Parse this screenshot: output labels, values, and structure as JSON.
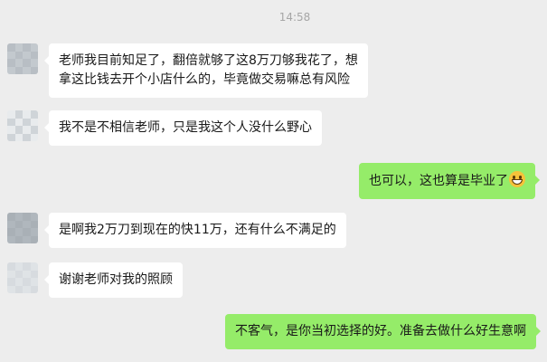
{
  "chat": {
    "timestamp": "14:58",
    "messages": [
      {
        "side": "left",
        "lines": [
          "老师我目前知足了，翻倍就够了这8万刀够我花了，想",
          "拿这比钱去开个小店什么的，毕竟做交易嘛总有风险"
        ]
      },
      {
        "side": "left",
        "lines": [
          "我不是不相信老师，只是我这个人没什么野心"
        ]
      },
      {
        "side": "right",
        "lines": [
          "也可以，这也算是毕业了"
        ],
        "emoji": "grinning-face-icon"
      },
      {
        "side": "left",
        "lines": [
          "是啊我2万刀到现在的快11万，还有什么不满足的"
        ]
      },
      {
        "side": "left",
        "lines": [
          "谢谢老师对我的照顾"
        ]
      },
      {
        "side": "right",
        "lines": [
          "不客气，是你当初选择的好。准备去做什么好生意啊"
        ]
      }
    ]
  },
  "colors": {
    "background": "#ededed",
    "incoming_bubble": "#ffffff",
    "outgoing_bubble": "#95ec69",
    "timestamp_text": "#a6a6a6"
  }
}
